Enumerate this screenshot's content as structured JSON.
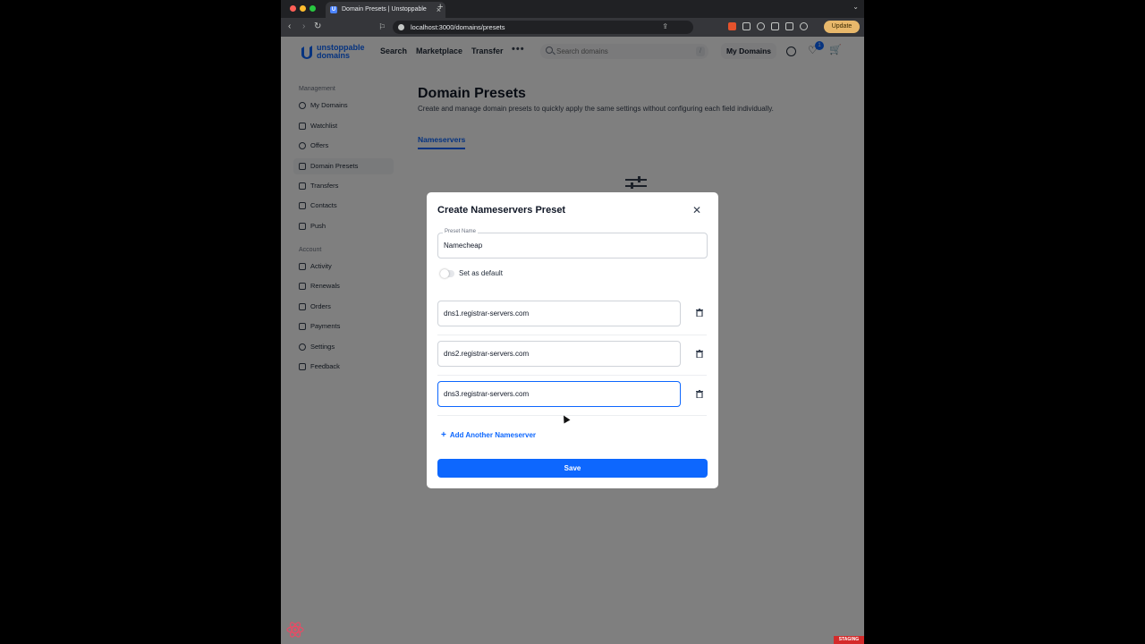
{
  "browser": {
    "tab_title": "Domain Presets | Unstoppable",
    "url": "localhost:3000/domains/presets",
    "update_label": "Update"
  },
  "header": {
    "logo_line1": "unstoppable",
    "logo_line2": "domains",
    "nav": [
      "Search",
      "Marketplace",
      "Transfer"
    ],
    "more_label": "•••",
    "search_placeholder": "Search domains",
    "search_shortcut": "/",
    "my_domains_label": "My Domains",
    "favorites_count": "1",
    "brand_color": "#0d67fe"
  },
  "sidebar": {
    "management_heading": "Management",
    "management_items": [
      "My Domains",
      "Watchlist",
      "Offers",
      "Domain Presets",
      "Transfers",
      "Contacts",
      "Push"
    ],
    "account_heading": "Account",
    "account_items": [
      "Activity",
      "Renewals",
      "Orders",
      "Payments",
      "Settings",
      "Feedback"
    ],
    "active_item": "Domain Presets"
  },
  "main": {
    "title": "Domain Presets",
    "subtitle": "Create and manage domain presets to quickly apply the same settings without configuring each field individually.",
    "tab": "Nameservers"
  },
  "dialog": {
    "title": "Create Nameservers Preset",
    "preset_name_label": "Preset Name",
    "preset_name_value": "Namecheap",
    "default_toggle_label": "Set as default",
    "default_toggle_on": false,
    "nameservers": [
      "dns1.registrar-servers.com",
      "dns2.registrar-servers.com",
      "dns3.registrar-servers.com"
    ],
    "add_label": "Add Another Nameserver",
    "save_label": "Save"
  },
  "footer": {
    "env_badge": "STAGING"
  }
}
